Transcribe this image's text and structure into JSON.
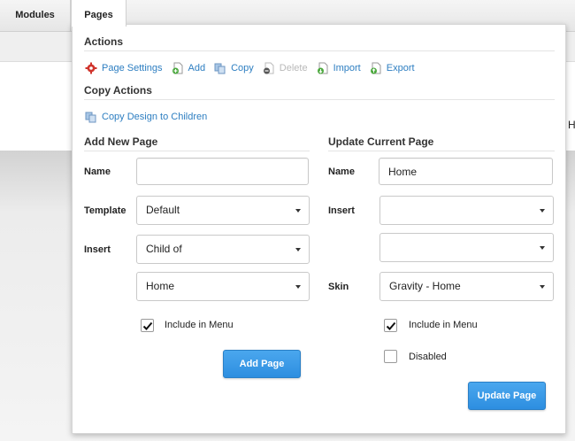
{
  "topbar": {
    "tabs": [
      "Modules",
      "Pages"
    ]
  },
  "background": {
    "peek_text": "H"
  },
  "panel": {
    "actions": {
      "title": "Actions",
      "items": [
        {
          "label": "Page Settings",
          "icon": "gear-icon",
          "enabled": true
        },
        {
          "label": "Add",
          "icon": "add-page-icon",
          "enabled": true
        },
        {
          "label": "Copy",
          "icon": "copy-icon",
          "enabled": true
        },
        {
          "label": "Delete",
          "icon": "delete-page-icon",
          "enabled": false
        },
        {
          "label": "Import",
          "icon": "import-icon",
          "enabled": true
        },
        {
          "label": "Export",
          "icon": "export-icon",
          "enabled": true
        }
      ]
    },
    "copy_actions": {
      "title": "Copy Actions",
      "copy_design_label": "Copy Design to Children"
    },
    "add_new_page": {
      "title": "Add New Page",
      "name_label": "Name",
      "name_value": "",
      "template_label": "Template",
      "template_value": "Default",
      "insert_label": "Insert",
      "insert_value": "Child of",
      "insert_target_value": "Home",
      "include_in_menu_label": "Include in Menu",
      "include_in_menu_checked": true,
      "add_button_label": "Add Page"
    },
    "update_current_page": {
      "title": "Update Current Page",
      "name_label": "Name",
      "name_value": "Home",
      "insert_label": "Insert",
      "insert_value": "",
      "insert_target_value": "",
      "skin_label": "Skin",
      "skin_value": "Gravity - Home",
      "include_in_menu_label": "Include in Menu",
      "include_in_menu_checked": true,
      "disabled_label": "Disabled",
      "disabled_checked": false,
      "update_button_label": "Update Page"
    }
  },
  "colors": {
    "link": "#2d7ec1",
    "disabled_link": "#b9b9b9",
    "button": "#2d8ee0"
  }
}
